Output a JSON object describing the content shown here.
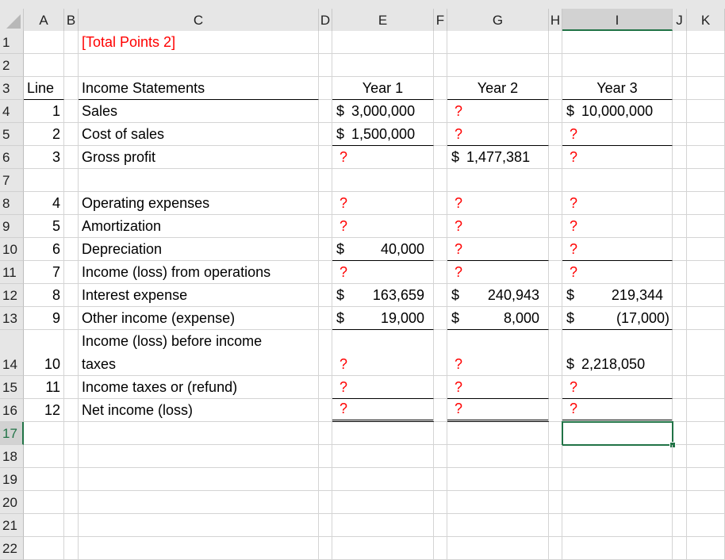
{
  "columns": [
    "A",
    "B",
    "C",
    "D",
    "E",
    "F",
    "G",
    "H",
    "I",
    "J",
    "K"
  ],
  "selected_cell": "I17",
  "accent_color": "#217346",
  "rows": [
    {
      "n": "1",
      "cells": {
        "C": {
          "t": "[Total Points 2]",
          "red": true
        }
      }
    },
    {
      "n": "2",
      "cells": {}
    },
    {
      "n": "3",
      "cells": {
        "A": {
          "t": "Line"
        },
        "C": {
          "t": "Income Statements"
        },
        "E": {
          "t": "Year 1",
          "center": true
        },
        "G": {
          "t": "Year 2",
          "center": true
        },
        "I": {
          "t": "Year 3",
          "center": true
        }
      }
    },
    {
      "n": "4",
      "cells": {
        "A": {
          "t": "1",
          "right": true
        },
        "C": {
          "t": "Sales"
        },
        "E": {
          "d": "$",
          "t": "3,000,000"
        },
        "G": {
          "t": "?",
          "red": true
        },
        "I": {
          "d": "$",
          "t": "10,000,000"
        }
      }
    },
    {
      "n": "5",
      "cells": {
        "A": {
          "t": "2",
          "right": true
        },
        "C": {
          "t": "Cost of sales"
        },
        "E": {
          "d": "$",
          "t": "1,500,000"
        },
        "G": {
          "t": "?",
          "red": true
        },
        "I": {
          "t": "?",
          "red": true
        }
      }
    },
    {
      "n": "6",
      "cells": {
        "A": {
          "t": "3",
          "right": true
        },
        "C": {
          "t": "Gross profit"
        },
        "E": {
          "t": "?",
          "red": true
        },
        "G": {
          "d": "$",
          "t": "1,477,381"
        },
        "I": {
          "t": "?",
          "red": true
        }
      }
    },
    {
      "n": "7",
      "cells": {}
    },
    {
      "n": "8",
      "cells": {
        "A": {
          "t": "4",
          "right": true
        },
        "C": {
          "t": "Operating expenses"
        },
        "E": {
          "t": "?",
          "red": true
        },
        "G": {
          "t": "?",
          "red": true
        },
        "I": {
          "t": "?",
          "red": true
        }
      }
    },
    {
      "n": "9",
      "cells": {
        "A": {
          "t": "5",
          "right": true
        },
        "C": {
          "t": "Amortization"
        },
        "E": {
          "t": "?",
          "red": true
        },
        "G": {
          "t": "?",
          "red": true
        },
        "I": {
          "t": "?",
          "red": true
        }
      }
    },
    {
      "n": "10",
      "cells": {
        "A": {
          "t": "6",
          "right": true
        },
        "C": {
          "t": "Depreciation"
        },
        "E": {
          "d": "$",
          "t": "40,000",
          "acct": true
        },
        "G": {
          "t": "?",
          "red": true
        },
        "I": {
          "t": "?",
          "red": true
        }
      }
    },
    {
      "n": "11",
      "cells": {
        "A": {
          "t": "7",
          "right": true
        },
        "C": {
          "t": "Income (loss) from operations"
        },
        "E": {
          "t": "?",
          "red": true
        },
        "G": {
          "t": "?",
          "red": true
        },
        "I": {
          "t": "?",
          "red": true
        }
      }
    },
    {
      "n": "12",
      "cells": {
        "A": {
          "t": "8",
          "right": true
        },
        "C": {
          "t": "Interest expense"
        },
        "E": {
          "d": "$",
          "t": "163,659",
          "acct": true
        },
        "G": {
          "d": "$",
          "t": "240,943",
          "acct": true
        },
        "I": {
          "d": "$",
          "t": "219,344",
          "acct": true
        }
      }
    },
    {
      "n": "13",
      "cells": {
        "A": {
          "t": "9",
          "right": true
        },
        "C": {
          "t": "Other income (expense)"
        },
        "E": {
          "d": "$",
          "t": "19,000",
          "acct": true
        },
        "G": {
          "d": "$",
          "t": "8,000",
          "acct": true
        },
        "I": {
          "d": "$",
          "t": "(17,000)",
          "acct": true,
          "paren": true
        }
      }
    },
    {
      "n": "14",
      "cells": {
        "A": {
          "t": "10",
          "right": true
        },
        "C": {
          "t": "Income (loss) before income",
          "t2": "taxes"
        },
        "E": {
          "t": "?",
          "red": true
        },
        "G": {
          "t": "?",
          "red": true
        },
        "I": {
          "d": "$",
          "t": "2,218,050"
        }
      }
    },
    {
      "n": "15",
      "cells": {
        "A": {
          "t": "11",
          "right": true
        },
        "C": {
          "t": "Income taxes or (refund)"
        },
        "E": {
          "t": "?",
          "red": true
        },
        "G": {
          "t": "?",
          "red": true
        },
        "I": {
          "t": "?",
          "red": true
        }
      }
    },
    {
      "n": "16",
      "cells": {
        "A": {
          "t": "12",
          "right": true
        },
        "C": {
          "t": "Net income (loss)"
        },
        "E": {
          "t": "?",
          "red": true
        },
        "G": {
          "t": "?",
          "red": true
        },
        "I": {
          "t": "?",
          "red": true
        }
      }
    },
    {
      "n": "17",
      "cells": {}
    },
    {
      "n": "18",
      "cells": {}
    },
    {
      "n": "19",
      "cells": {}
    },
    {
      "n": "20",
      "cells": {}
    },
    {
      "n": "21",
      "cells": {}
    },
    {
      "n": "22",
      "cells": {}
    }
  ]
}
